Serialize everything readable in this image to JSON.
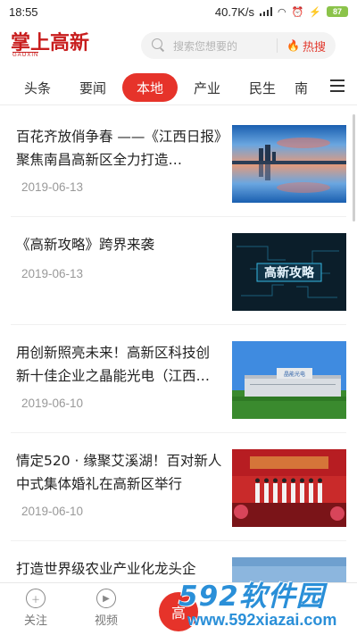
{
  "status": {
    "time": "18:55",
    "network_speed": "40.7K/s",
    "battery": "87"
  },
  "header": {
    "logo_text": "掌上高新",
    "logo_sub": "GAOXIN",
    "search_placeholder": "搜索您想要的",
    "hot_label": "热搜"
  },
  "tabs": [
    {
      "label": "头条",
      "active": false
    },
    {
      "label": "要闻",
      "active": false
    },
    {
      "label": "本地",
      "active": true
    },
    {
      "label": "产业",
      "active": false
    },
    {
      "label": "民生",
      "active": false
    },
    {
      "label": "南",
      "active": false
    }
  ],
  "articles": [
    {
      "title": "百花齐放俏争春 ——《江西日报》聚焦南昌高新区全力打造…",
      "date": "2019-06-13",
      "image": "city-skyline-reflection"
    },
    {
      "title": "《高新攻略》跨界来袭",
      "date": "2019-06-13",
      "image": "gaoxin-gonglue-banner",
      "image_text": "高新攻略"
    },
    {
      "title": "用创新照亮未来！高新区科技创新十佳企业之晶能光电（江西…",
      "date": "2019-06-10",
      "image": "factory-building",
      "image_text": "晶能光电"
    },
    {
      "title": "情定520 · 缘聚艾溪湖！百对新人中式集体婚礼在高新区举行",
      "date": "2019-06-10",
      "image": "wedding-ceremony-stage"
    },
    {
      "title": "打造世界级农业产业化龙头企",
      "date": "",
      "image": "partial"
    }
  ],
  "bottom_nav": [
    {
      "label": "关注",
      "icon": "plus-icon"
    },
    {
      "label": "视频",
      "icon": "play-icon"
    },
    {
      "label": "高",
      "icon": "center-icon"
    }
  ],
  "watermark": {
    "brand": "592软件园",
    "url": "www.592xiazai.com"
  },
  "colors": {
    "accent": "#e6332a",
    "logo": "#c81d1d",
    "watermark": "#2a8fd8"
  }
}
